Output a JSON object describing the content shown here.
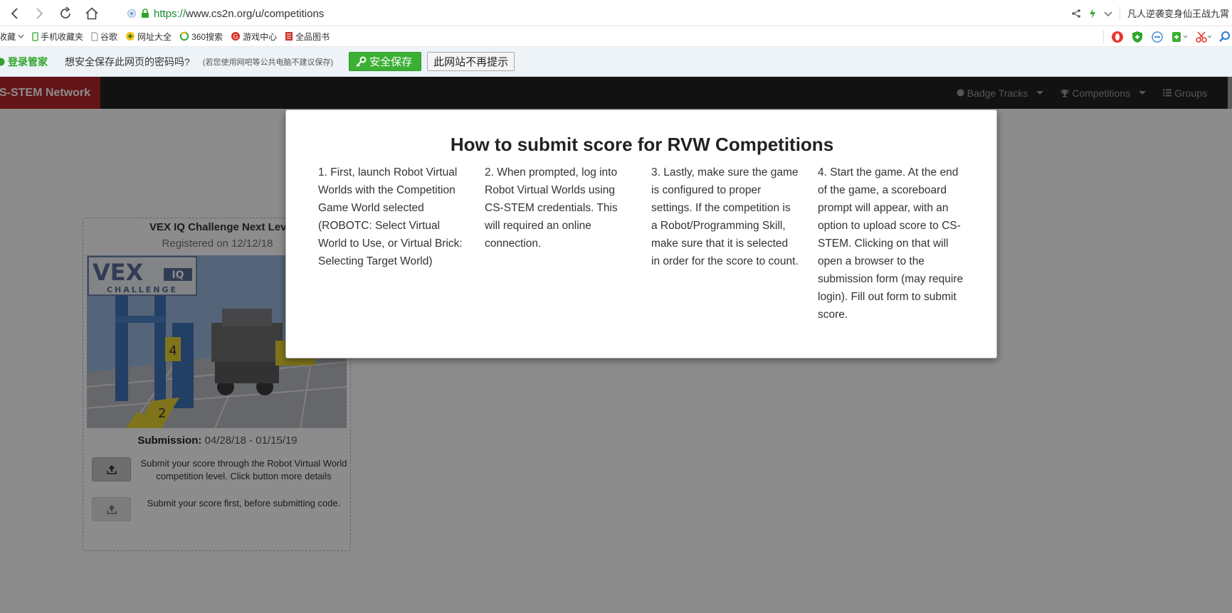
{
  "browser": {
    "url_protocol": "https://",
    "url_host": "www.cs2n.org",
    "url_path": "/u/competitions",
    "tab_title": "凡人逆袭变身仙王战九霄"
  },
  "bookmarks": [
    {
      "label": "收藏",
      "icon": "star-icon"
    },
    {
      "label": "手机收藏夹",
      "icon": "phone-icon"
    },
    {
      "label": "谷歌",
      "icon": "page-icon"
    },
    {
      "label": "网址大全",
      "icon": "web-directory-icon"
    },
    {
      "label": "360搜索",
      "icon": "search-360-icon"
    },
    {
      "label": "游戏中心",
      "icon": "game-center-icon"
    },
    {
      "label": "全品图书",
      "icon": "book-icon"
    }
  ],
  "password_bar": {
    "login_label": "登录管家",
    "question": "想安全保存此网页的密码吗?",
    "hint": "(若您使用网吧等公共电脑不建议保存)",
    "save_label": "安全保存",
    "never_label": "此网站不再提示"
  },
  "site_nav": {
    "brand": "S-STEM Network",
    "links": [
      {
        "label": "Badge Tracks",
        "icon": "circle-icon"
      },
      {
        "label": "Competitions",
        "icon": "trophy-icon"
      },
      {
        "label": "Groups",
        "icon": "list-icon"
      }
    ]
  },
  "competition_card": {
    "title": "VEX IQ Challenge Next Level",
    "registered": "Registered on 12/12/18",
    "submission_label": "Submission:",
    "submission_dates": "04/28/18 - 01/15/19",
    "upload_score_text": "Submit your score through the Robot Virtual World competition level. Click button more details",
    "upload_code_text": "Submit your score first, before submitting code."
  },
  "modal": {
    "title": "How to submit score for RVW Competitions",
    "steps": [
      "1. First, launch Robot Virtual Worlds with the Competition Game World selected (ROBOTC: Select Virtual World to Use, or Virtual Brick: Selecting Target World)",
      "2. When prompted, log into Robot Virtual Worlds using CS-STEM credentials. This will required an online connection.",
      "3. Lastly, make sure the game is configured to proper settings. If the competition is a Robot/Programming Skill, make sure that it is selected in order for the score to count.",
      "4. Start the game. At the end of the game, a scoreboard prompt will appear, with an option to upload score to CS-STEM. Clicking on that will open a browser to the submission form (may require login). Fill out form to submit score."
    ]
  },
  "colors": {
    "brand_red": "#b5262a",
    "nav_dark": "#222222",
    "save_green": "#3cb034",
    "overlay": "rgba(0,0,0,0.45)"
  }
}
